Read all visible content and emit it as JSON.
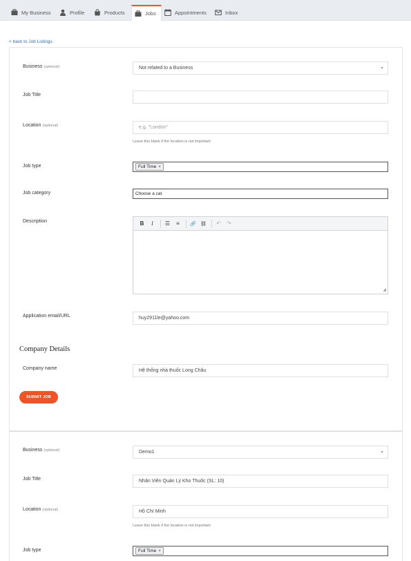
{
  "tabs": [
    {
      "label": "My Business",
      "icon": "briefcase-icon"
    },
    {
      "label": "Profile",
      "icon": "user-icon"
    },
    {
      "label": "Products",
      "icon": "shopping-bag-icon"
    },
    {
      "label": "Jobs",
      "icon": "briefcase-icon",
      "active": true
    },
    {
      "label": "Appointments",
      "icon": "calendar-icon"
    },
    {
      "label": "Inbox",
      "icon": "envelope-icon"
    }
  ],
  "back_link": "< back to Job Listings",
  "form1": {
    "business": {
      "label": "Business",
      "optional": "(optional)",
      "value": "Not related to a Business"
    },
    "job_title": {
      "label": "Job Title",
      "value": ""
    },
    "location": {
      "label": "Location",
      "optional": "(optional)",
      "placeholder": "e.g. \"London\"",
      "hint": "Leave this blank if the location is not important"
    },
    "job_type": {
      "label": "Job type",
      "tag": "Full Time",
      "remove": "×"
    },
    "job_category": {
      "label": "Job category",
      "value": "Choose a cat"
    },
    "description": {
      "label": "Description",
      "toolbar": [
        "B",
        "I",
        "☰",
        "≡",
        "🔗",
        "⛓",
        "↶",
        "↷"
      ]
    },
    "application": {
      "label": "Application email/URL",
      "value": "huy2911le@yahoo.com"
    },
    "company_section": "Company Details",
    "company_name": {
      "label": "Company name",
      "value": "Hệ thống nhà thuốc Long Châu"
    },
    "submit": "SUBMIT JOB"
  },
  "form2": {
    "business": {
      "label": "Business",
      "optional": "(optional)",
      "value": "Demo1"
    },
    "job_title": {
      "label": "Job Title",
      "value": "Nhân Viên Quản Lý Kho Thuốc (SL: 10)"
    },
    "location": {
      "label": "Location",
      "optional": "(optional)",
      "value": "Hồ Chí Minh",
      "hint": "Leave this blank if the location is not important"
    },
    "job_type": {
      "label": "Job type",
      "tag": "Full Time",
      "remove": "×"
    }
  },
  "colors": {
    "accent": "#ef5424",
    "link": "#2a6fb3",
    "tab_active_border": "#e85a2a"
  }
}
